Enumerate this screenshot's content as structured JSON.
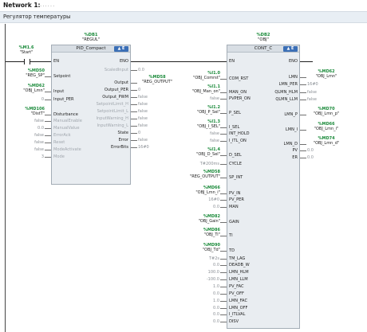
{
  "network": {
    "title": "Network 1:",
    "title_dots": "......",
    "comment": "Регулятор температуры"
  },
  "contact": {
    "address": "%M1.6",
    "symbol": "\"Start\""
  },
  "pid_block": {
    "db_number": "%DB1",
    "db_name": "\"REGUL\"",
    "title": "PID_Compact",
    "badge": "▲ E",
    "inputs": [
      {
        "pin": "EN",
        "addr": "",
        "sym": "",
        "value": "",
        "grey": false
      },
      {
        "pin": "Setpoint",
        "addr": "%MD50",
        "sym": "\"REG_SP\"",
        "value": "",
        "grey": false
      },
      {
        "pin": "Input",
        "addr": "%MD62",
        "sym": "\"OBJ_Lmn\"",
        "value": "",
        "grey": false
      },
      {
        "pin": "Input_PER",
        "addr": "",
        "sym": "",
        "value": "0",
        "grey": false
      },
      {
        "pin": "Disturbance",
        "addr": "%MD106",
        "sym": "\"DistT\"",
        "value": "",
        "grey": false
      },
      {
        "pin": "ManualEnable",
        "addr": "",
        "sym": "",
        "value": "false",
        "grey": true
      },
      {
        "pin": "ManualValue",
        "addr": "",
        "sym": "",
        "value": "0.0",
        "grey": true
      },
      {
        "pin": "ErrorAck",
        "addr": "",
        "sym": "",
        "value": "false",
        "grey": true
      },
      {
        "pin": "Reset",
        "addr": "",
        "sym": "",
        "value": "false",
        "grey": true
      },
      {
        "pin": "ModeActivate",
        "addr": "",
        "sym": "",
        "value": "false",
        "grey": true
      },
      {
        "pin": "Mode",
        "addr": "",
        "sym": "",
        "value": "3",
        "grey": true
      }
    ],
    "outputs": [
      {
        "pin": "ENO",
        "value": "",
        "addr": "",
        "sym": "",
        "grey": false
      },
      {
        "pin": "ScaledInput",
        "value": "0.0",
        "addr": "",
        "sym": "",
        "grey": true
      },
      {
        "pin": "Output",
        "value": "",
        "addr": "%MD58",
        "sym": "\"REG_OUTPUT\"",
        "grey": false
      },
      {
        "pin": "Output_PER",
        "value": "0",
        "addr": "",
        "sym": "",
        "grey": false
      },
      {
        "pin": "Output_PWM",
        "value": "false",
        "addr": "",
        "sym": "",
        "grey": false
      },
      {
        "pin": "SetpointLimit_H",
        "value": "false",
        "addr": "",
        "sym": "",
        "grey": true
      },
      {
        "pin": "SetpointLimit_L",
        "value": "false",
        "addr": "",
        "sym": "",
        "grey": true
      },
      {
        "pin": "InputWarning_H",
        "value": "false",
        "addr": "",
        "sym": "",
        "grey": true
      },
      {
        "pin": "InputWarning_L",
        "value": "false",
        "addr": "",
        "sym": "",
        "grey": true
      },
      {
        "pin": "State",
        "value": "0",
        "addr": "",
        "sym": "",
        "grey": false
      },
      {
        "pin": "Error",
        "value": "false",
        "addr": "",
        "sym": "",
        "grey": false
      },
      {
        "pin": "ErrorBits",
        "value": "16#0",
        "addr": "",
        "sym": "",
        "grey": false
      }
    ]
  },
  "obj_block": {
    "db_number": "%DB2",
    "db_name": "\"OBJ\"",
    "title": "CONT_C",
    "badge": "▲ E",
    "inputs": [
      {
        "pin": "EN",
        "addr": "",
        "sym": "",
        "value": ""
      },
      {
        "pin": "COM_RST",
        "addr": "%I1.0",
        "sym": "\"OBJ_Comrst\"",
        "value": ""
      },
      {
        "pin": "MAN_ON",
        "addr": "%I1.1",
        "sym": "\"OBJ_Man_on\"",
        "value": ""
      },
      {
        "pin": "PVPER_ON",
        "addr": "",
        "sym": "",
        "value": "false"
      },
      {
        "pin": "P_SEL",
        "addr": "%I1.2",
        "sym": "\"OBJ_P_Sel\"",
        "value": ""
      },
      {
        "pin": "I_SEL",
        "addr": "%I1.3",
        "sym": "\"OBJ_I_SEL\"",
        "value": ""
      },
      {
        "pin": "INT_HOLD",
        "addr": "",
        "sym": "",
        "value": "false"
      },
      {
        "pin": "I_ITL_ON",
        "addr": "",
        "sym": "",
        "value": "false"
      },
      {
        "pin": "D_SEL",
        "addr": "%I1.4",
        "sym": "\"OBJ_D_Sel\"",
        "value": ""
      },
      {
        "pin": "CYCLE",
        "addr": "",
        "sym": "",
        "value": "T#200ms"
      },
      {
        "pin": "SP_INT",
        "addr": "%MD58",
        "sym": "\"REG_OUTPUT\"",
        "value": ""
      },
      {
        "pin": "PV_IN",
        "addr": "%MD66",
        "sym": "\"OBJ_Lmn_i\"",
        "value": ""
      },
      {
        "pin": "PV_PER",
        "addr": "",
        "sym": "",
        "value": "16#0"
      },
      {
        "pin": "MAN",
        "addr": "",
        "sym": "",
        "value": "0.0"
      },
      {
        "pin": "GAIN",
        "addr": "%MD82",
        "sym": "\"OBJ_Gain\"",
        "value": ""
      },
      {
        "pin": "TI",
        "addr": "%MD86",
        "sym": "\"OBJ_Ti\"",
        "value": ""
      },
      {
        "pin": "TD",
        "addr": "%MD90",
        "sym": "\"OBJ_Td\"",
        "value": ""
      },
      {
        "pin": "TM_LAG",
        "addr": "",
        "sym": "",
        "value": "T#2s"
      },
      {
        "pin": "DEADB_W",
        "addr": "",
        "sym": "",
        "value": "0.0"
      },
      {
        "pin": "LMN_HLM",
        "addr": "",
        "sym": "",
        "value": "100.0"
      },
      {
        "pin": "LMN_LLM",
        "addr": "",
        "sym": "",
        "value": "-100.0"
      },
      {
        "pin": "PV_FAC",
        "addr": "",
        "sym": "",
        "value": "1.0"
      },
      {
        "pin": "PV_OFF",
        "addr": "",
        "sym": "",
        "value": "0.0"
      },
      {
        "pin": "LMN_FAC",
        "addr": "",
        "sym": "",
        "value": "1.0"
      },
      {
        "pin": "LMN_OFF",
        "addr": "",
        "sym": "",
        "value": "0.0"
      },
      {
        "pin": "I_ITLVAL",
        "addr": "",
        "sym": "",
        "value": "0.0"
      },
      {
        "pin": "DISV",
        "addr": "",
        "sym": "",
        "value": "0.0"
      }
    ],
    "outputs": [
      {
        "pin": "ENO",
        "value": "",
        "addr": "",
        "sym": ""
      },
      {
        "pin": "LMN",
        "value": "",
        "addr": "%MD62",
        "sym": "\"OBJ_Lmn\""
      },
      {
        "pin": "LMN_PER",
        "value": "16#0",
        "addr": "",
        "sym": ""
      },
      {
        "pin": "QLMN_HLM",
        "value": "false",
        "addr": "",
        "sym": ""
      },
      {
        "pin": "QLMN_LLM",
        "value": "false",
        "addr": "",
        "sym": ""
      },
      {
        "pin": "LMN_P",
        "value": "",
        "addr": "%MD70",
        "sym": "\"OBJ_Lmn_p\""
      },
      {
        "pin": "LMN_I",
        "value": "",
        "addr": "%MD66",
        "sym": "\"OBJ_Lmn_i\""
      },
      {
        "pin": "LMN_D",
        "value": "",
        "addr": "%MD74",
        "sym": "\"OBJ_Lmn_d\""
      },
      {
        "pin": "PV",
        "value": "0.0",
        "addr": "",
        "sym": ""
      },
      {
        "pin": "ER",
        "value": "0.0",
        "addr": "",
        "sym": ""
      }
    ]
  }
}
